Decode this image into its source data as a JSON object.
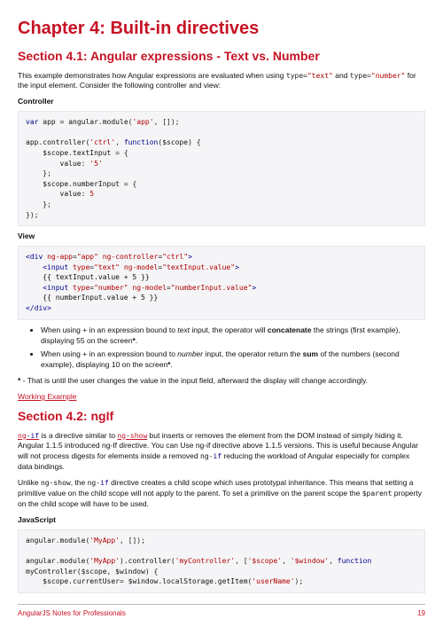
{
  "chapter": {
    "title": "Chapter 4: Built-in directives"
  },
  "section41": {
    "title": "Section 4.1: Angular expressions - Text vs. Number",
    "intro_a": "This example demonstrates how Angular expressions are evaluated when using ",
    "intro_b": " and ",
    "intro_c": " for the input element. Consider the following controller and view:",
    "controller_label": "Controller",
    "view_label": "View",
    "bullets": {
      "b1a": "When using + in an expression bound to ",
      "b1em": "text",
      "b1b": " input, the operator will ",
      "b1strong": "concatenate",
      "b1c": " the strings (first example), displaying 55 on the screen",
      "b1star": "*",
      "b1d": ".",
      "b2a": "When using + in an expression bound to ",
      "b2em": "number",
      "b2b": " input, the operator return the ",
      "b2strong": "sum",
      "b2c": " of the numbers (second example), displaying 10 on the screen",
      "b2star": "*",
      "b2d": "."
    },
    "note_a": "*",
    "note_b": " - That is until the user changes the value in the input field, afterward the display will change accordingly.",
    "link": "Working Example"
  },
  "section42": {
    "title": "Section 4.2: ngIf",
    "p1a": " is a directive similar to ",
    "p1b": " but inserts or removes the element from the DOM instead of simply hiding it. Angular 1.1.5 introduced ng-If directive. You can Use ng-if directive above 1.1.5 versions. This is useful because Angular will not process digests for elements inside a removed ",
    "p1c": " reducing the workload of Angular especially for complex data bindings.",
    "p2a": "Unlike ",
    "p2b": ", the ",
    "p2c": " directive creates a child scope which uses prototypal inheritance. This means that setting a primitive value on the child scope will not apply to the parent. To set a primitive on the parent scope the ",
    "p2d": " property on the child scope will have to be used.",
    "js_label": "JavaScript"
  },
  "code_tokens": {
    "type_text": "type",
    "eq": "=",
    "quote_text": "\"text\"",
    "quote_number": "\"number\"",
    "ng_if": "ng",
    "dash": "-",
    "if_word": "if",
    "ng_show": "ng",
    "show_word": "show",
    "ng_show2": "ng-show",
    "ng_if2": "ng",
    "if2": "if",
    "parent": "$parent"
  },
  "footer": {
    "left": "AngularJS Notes for Professionals",
    "right": "19"
  }
}
